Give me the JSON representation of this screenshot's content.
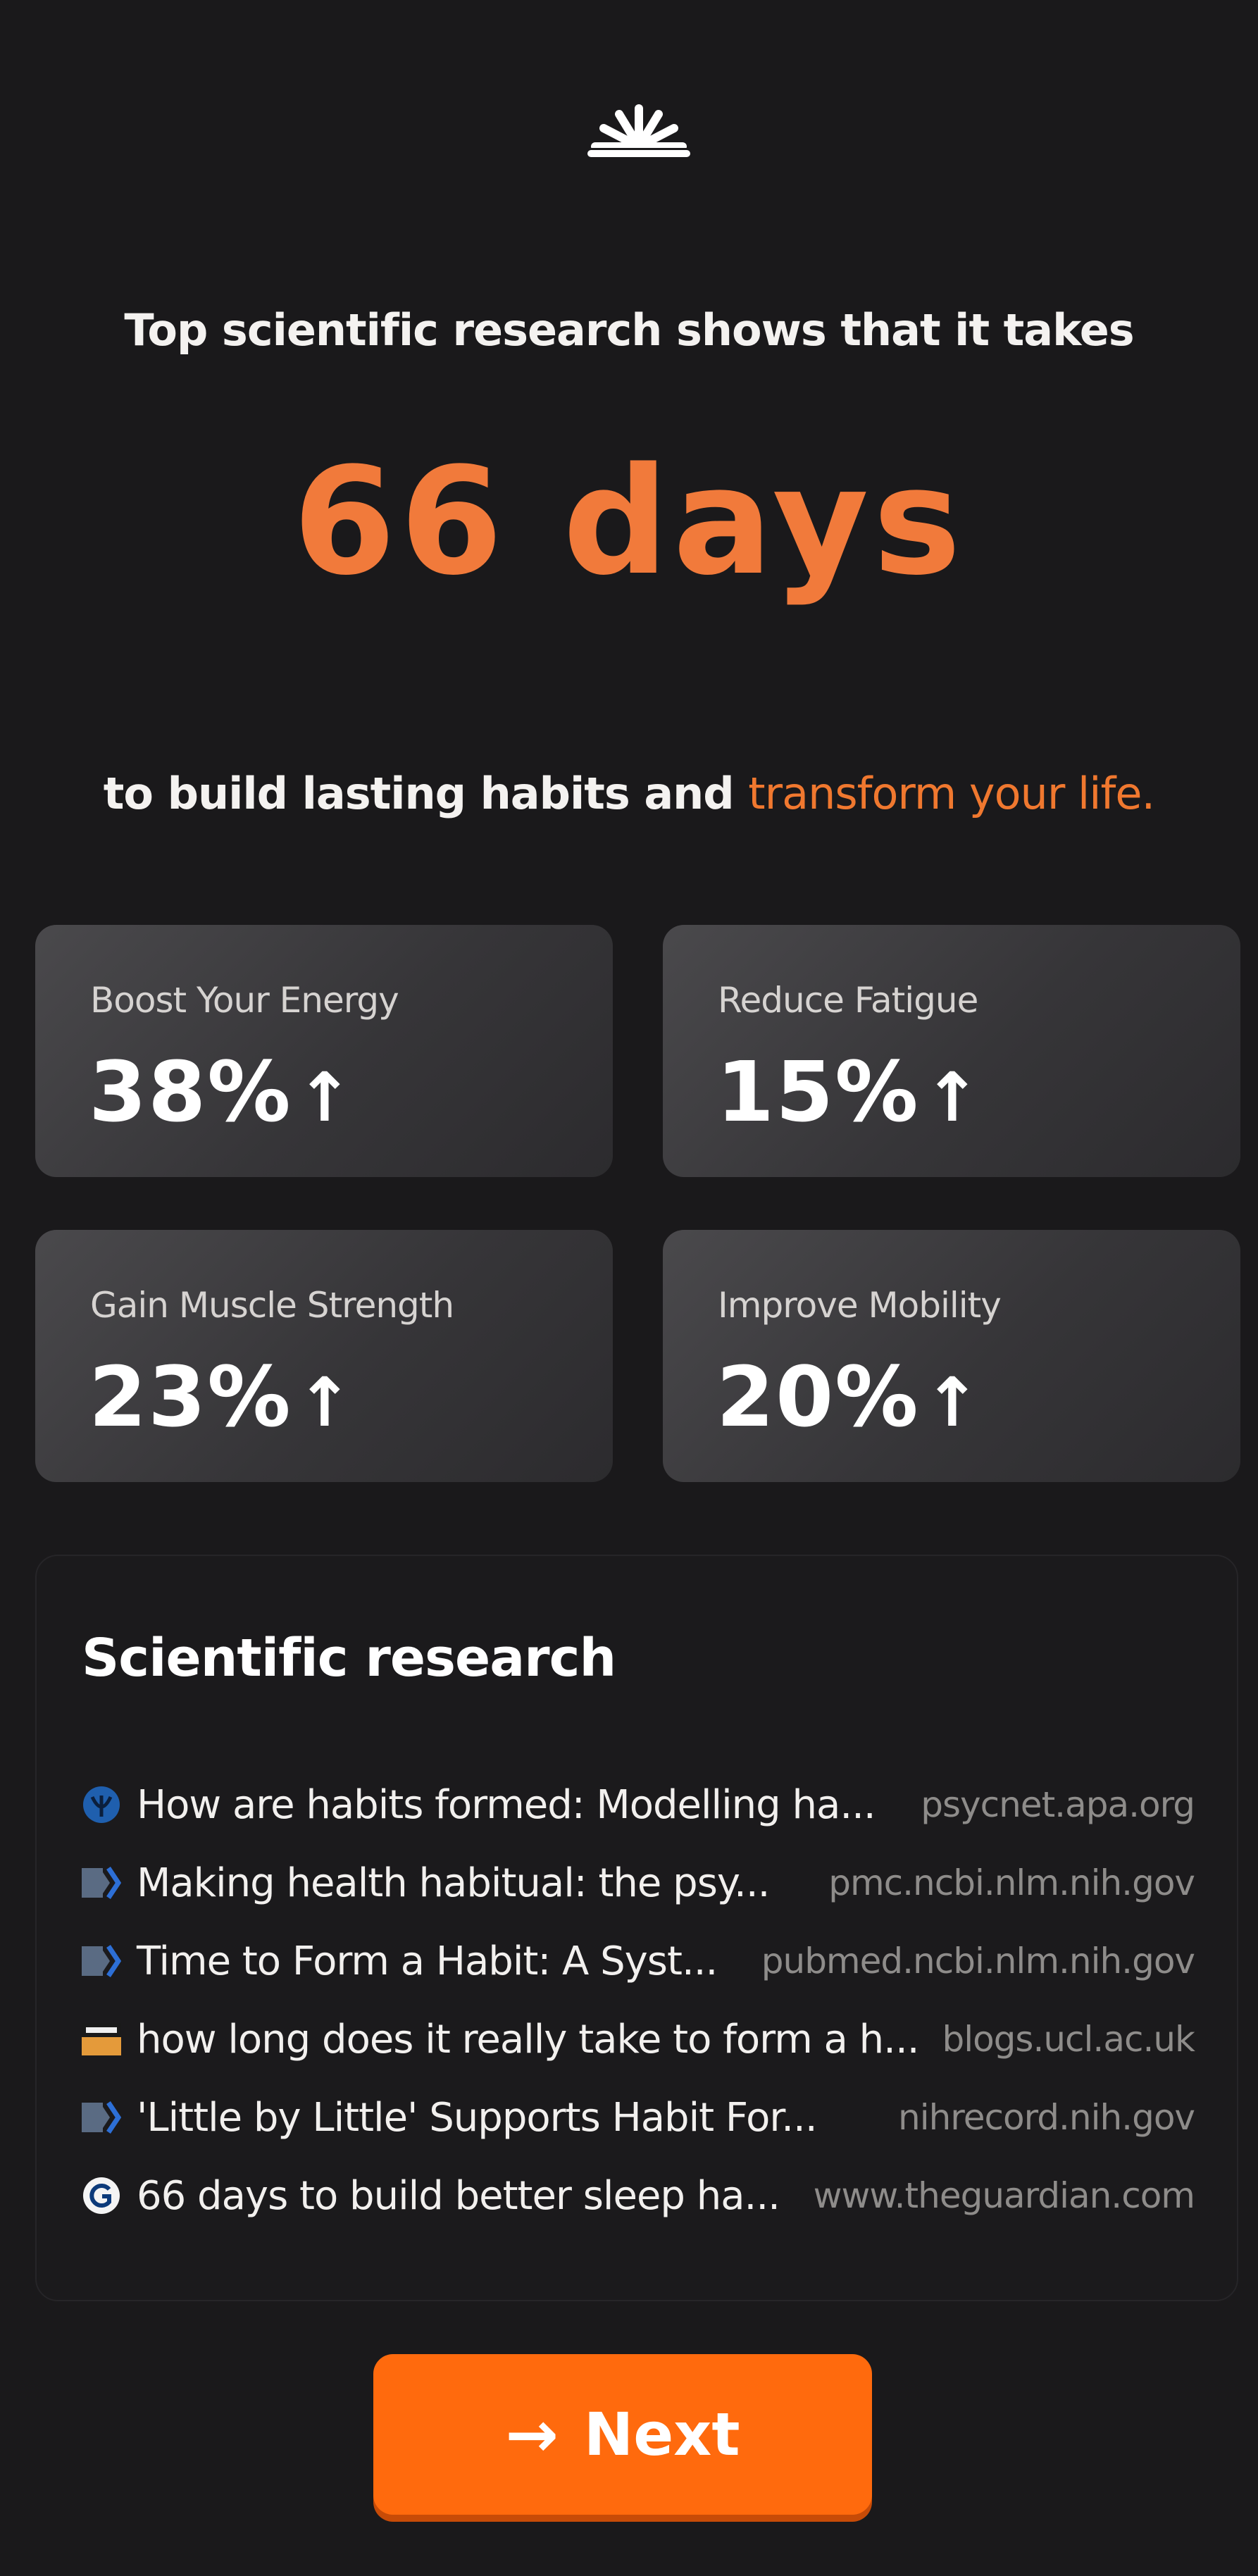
{
  "header": {
    "logo_icon": "sunrise-icon",
    "intro": "Top scientific research shows that it takes",
    "headline": "66 days",
    "outro_plain": "to build lasting habits and ",
    "outro_accent": "transform your life.",
    "accent_color": "#f0782f"
  },
  "stats": [
    {
      "label": "Boost Your Energy",
      "value": "38%",
      "arrow": "↑"
    },
    {
      "label": "Reduce Fatigue",
      "value": "15%",
      "arrow": "↑"
    },
    {
      "label": "Gain Muscle Strength",
      "value": "23%",
      "arrow": "↑"
    },
    {
      "label": "Improve Mobility",
      "value": "20%",
      "arrow": "↑"
    }
  ],
  "research": {
    "heading": "Scientific research",
    "items": [
      {
        "icon": "apa-icon",
        "title": "How are habits formed: Modelling ha...",
        "domain": "psycnet.apa.org"
      },
      {
        "icon": "ncbi-icon",
        "title": "Making health habitual: the psy...",
        "domain": "pmc.ncbi.nlm.nih.gov"
      },
      {
        "icon": "pubmed-icon",
        "title": "Time to Form a Habit: A Syst...",
        "domain": "pubmed.ncbi.nlm.nih.gov"
      },
      {
        "icon": "ucl-icon",
        "title": "how long does it really take to form a h...",
        "domain": "blogs.ucl.ac.uk"
      },
      {
        "icon": "nih-icon",
        "title": "'Little by Little' Supports Habit For...",
        "domain": "nihrecord.nih.gov"
      },
      {
        "icon": "guardian-icon",
        "title": "66 days to build better sleep ha...",
        "domain": "www.theguardian.com"
      }
    ]
  },
  "cta": {
    "arrow_icon": "arrow-right-icon",
    "label": "Next",
    "color": "#ff6a0d"
  }
}
